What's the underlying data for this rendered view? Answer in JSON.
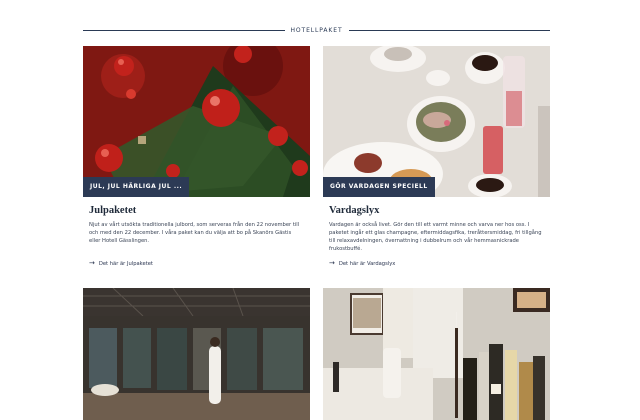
{
  "section": {
    "title": "HOTELLPAKET"
  },
  "cards": [
    {
      "tag": "JUL, JUL HÄRLIGA JUL ...",
      "title": "Julpaketet",
      "description": "Njut av vårt utsökta traditionella julbord, som serveras från den 22 november till och med den 22 december. I våra paket kan du välja att bo på Skanörs Gästis eller Hotell Gässlingen.",
      "link": "Det här är Julpaketet"
    },
    {
      "tag": "GÖR VARDAGEN SPECIELL",
      "title": "Vardagslyx",
      "description": "Vardagen är också livet. Gör den till ett varmt minne och varva ner hos oss. I paketet ingår ett glas champagne, eftermiddagsfika, treråttersmiddag, fri tillgång till relaxavdelningen, övernattning i dubbelrum och vår hemmasnickrade frukostbuffé.",
      "link": "Det här är Vardagslyx"
    }
  ],
  "icons": {
    "link_arrow": "arrow-right-icon"
  },
  "colors": {
    "tag_bg": "#2c3a55",
    "accent": "#2a3a55"
  }
}
